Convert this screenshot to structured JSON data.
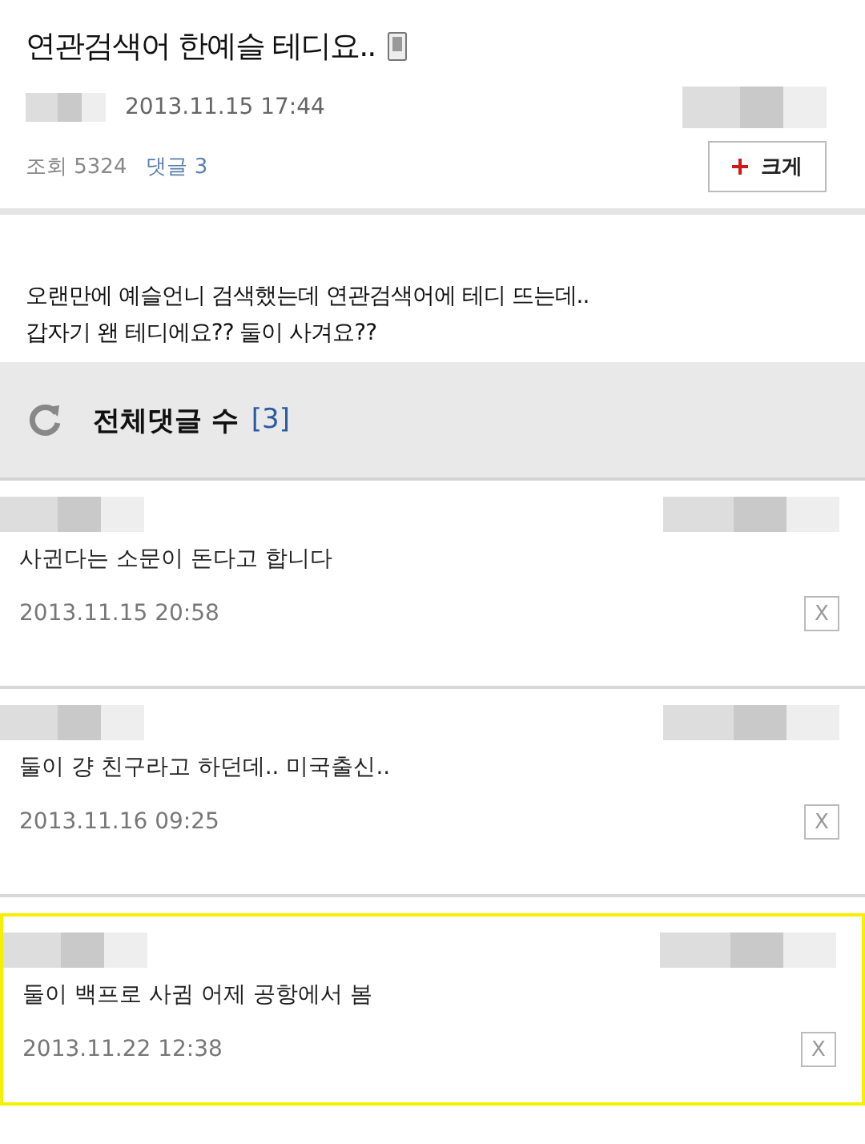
{
  "post": {
    "title": "연관검색어 한예슬 테디요..",
    "date": "2013.11.15 17:44",
    "views": "조회 5324",
    "comments_link": "댓글 3",
    "zoom_button": "크게",
    "body": "오랜만에 예슬언니 검색했는데 연관검색어에 테디 뜨는데..\n갑자기 왠 테디에요?? 둘이 사겨요??"
  },
  "comments_header": {
    "label": "전체댓글 수",
    "count": "[3]"
  },
  "comments": [
    {
      "text": "사귄다는 소문이 돈다고 합니다",
      "date": "2013.11.15 20:58",
      "delete": "X",
      "highlighted": false
    },
    {
      "text": "둘이 걍 친구라고 하던데.. 미국출신..",
      "date": "2013.11.16 09:25",
      "delete": "X",
      "highlighted": false
    },
    {
      "text": "둘이 백프로 사귐 어제 공항에서 봄",
      "date": "2013.11.22 12:38",
      "delete": "X",
      "highlighted": true
    }
  ]
}
